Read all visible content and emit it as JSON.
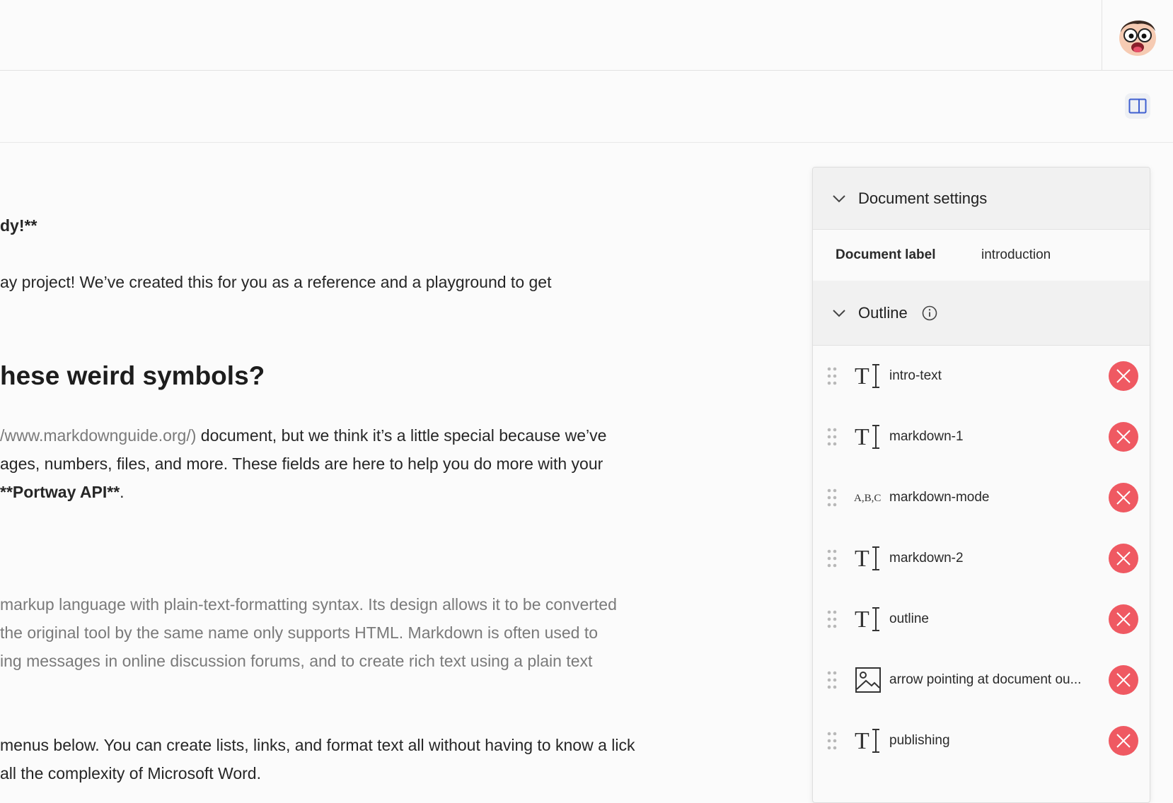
{
  "editor": {
    "line1_bold": "dy!**",
    "line2": "ay project! We’ve created this for you as a reference and a playground to get",
    "heading": "hese weird symbols?",
    "p1_link": "/www.markdownguide.org/)",
    "p1_rest": " document, but we think it’s a little special because we’ve",
    "p2": "ages, numbers, files, and more. These fields are here to help you do more with your",
    "p3_bold": "**Portway API**",
    "p3_rest": ".",
    "p4": " markup language with plain-text-formatting syntax. Its design allows it to be converted",
    "p5": "the original tool by the same name only supports HTML. Markdown is often used to",
    "p6": "ing messages in online discussion forums, and to create rich text using a plain text",
    "p7": "menus below. You can create lists, links, and format text all without having to know a lick",
    "p8": "all the complexity of Microsoft Word."
  },
  "settings": {
    "title": "Document settings",
    "label_key": "Document label",
    "label_value": "introduction"
  },
  "outline": {
    "title": "Outline",
    "items": [
      {
        "label": "intro-text",
        "icon": "text-field-icon"
      },
      {
        "label": "markdown-1",
        "icon": "text-field-icon"
      },
      {
        "label": "markdown-mode",
        "icon": "choice-field-icon"
      },
      {
        "label": "markdown-2",
        "icon": "text-field-icon"
      },
      {
        "label": "outline",
        "icon": "text-field-icon"
      },
      {
        "label": "arrow pointing at document ou...",
        "icon": "image-field-icon"
      },
      {
        "label": "publishing",
        "icon": "text-field-icon"
      }
    ]
  },
  "colors": {
    "delete": "#ef5962",
    "toggle": "#3f5fd0"
  }
}
